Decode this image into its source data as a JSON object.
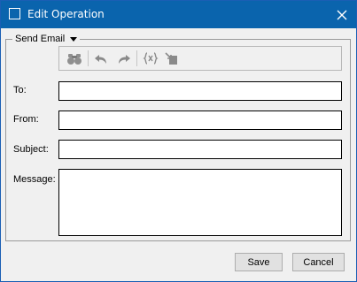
{
  "window": {
    "title": "Edit Operation",
    "titlebar_color": "#0a64ad"
  },
  "group": {
    "label": "Send Email"
  },
  "toolbar": {
    "buttons": [
      {
        "icon": "binoculars-icon"
      },
      {
        "icon": "undo-icon"
      },
      {
        "icon": "redo-icon"
      },
      {
        "icon": "variables-icon"
      },
      {
        "icon": "insert-field-icon"
      }
    ]
  },
  "form": {
    "to_label": "To:",
    "to_value": "",
    "from_label": "From:",
    "from_value": "",
    "subject_label": "Subject:",
    "subject_value": "",
    "message_label": "Message:",
    "message_value": ""
  },
  "actions": {
    "save_label": "Save",
    "cancel_label": "Cancel"
  }
}
